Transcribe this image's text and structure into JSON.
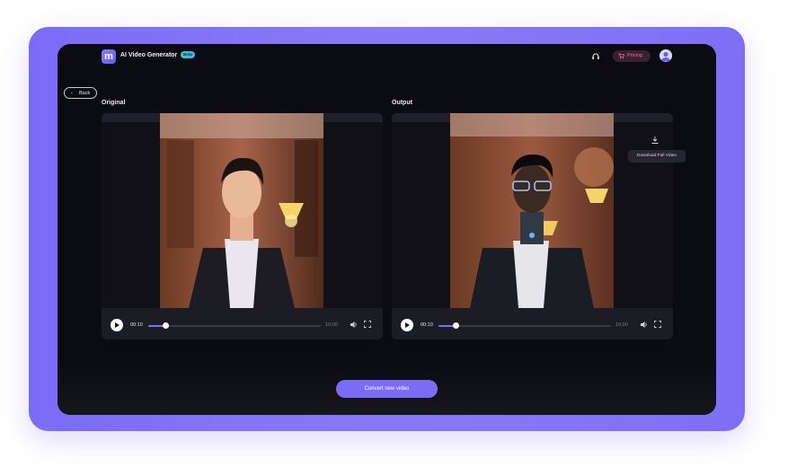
{
  "header": {
    "app_title": "AI Video Generator",
    "beta_badge": "Beta",
    "pricing_label": "Pricing",
    "support_icon": "headset-icon",
    "cart_icon": "cart-icon",
    "avatar_icon": "user-avatar-icon"
  },
  "nav": {
    "back_label": "Back"
  },
  "original": {
    "label": "Original",
    "current_time": "00:10",
    "duration": "10:00",
    "progress": 0.1
  },
  "output": {
    "label": "Output",
    "current_time": "00:10",
    "duration": "10:00",
    "progress": 0.1,
    "download_tooltip": "Download Full Video"
  },
  "actions": {
    "convert_label": "Convert new video"
  },
  "colors": {
    "accent": "#7b6cf6",
    "background": "#0b0b12",
    "pricing_text": "#f36fa4"
  }
}
